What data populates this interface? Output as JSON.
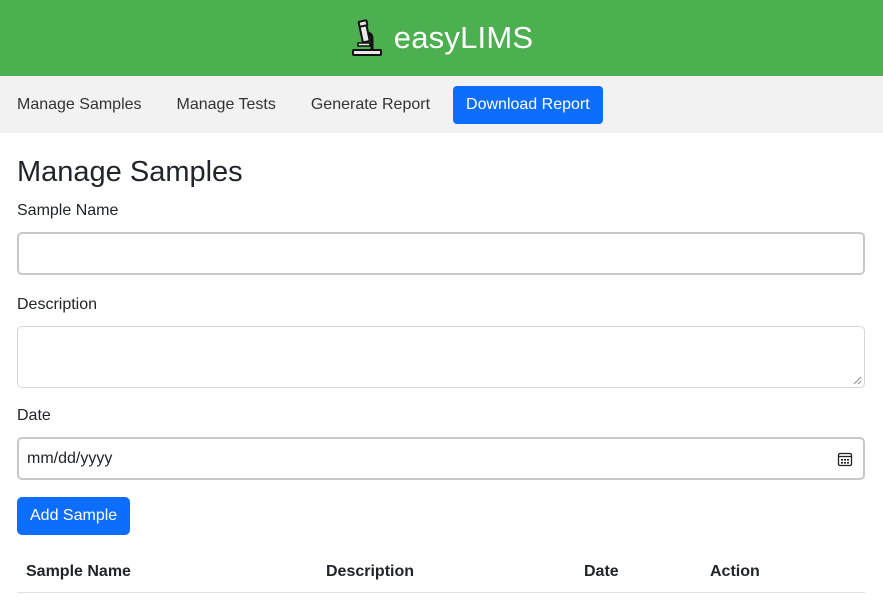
{
  "app": {
    "title": "easyLIMS",
    "icon": "microscope-icon"
  },
  "nav": {
    "items": [
      {
        "label": "Manage Samples"
      },
      {
        "label": "Manage Tests"
      },
      {
        "label": "Generate Report"
      },
      {
        "label": "Download Report",
        "active": true
      }
    ]
  },
  "page": {
    "title": "Manage Samples"
  },
  "form": {
    "sample_name": {
      "label": "Sample Name",
      "value": ""
    },
    "description": {
      "label": "Description",
      "value": ""
    },
    "date": {
      "label": "Date",
      "placeholder": "mm/dd/yyyy",
      "icon": "calendar-icon"
    },
    "submit_label": "Add Sample"
  },
  "table": {
    "columns": [
      "Sample Name",
      "Description",
      "Date",
      "Action"
    ],
    "rows": []
  },
  "colors": {
    "header_bg": "#4caf50",
    "nav_bg": "#f2f2f2",
    "primary": "#0d6efd"
  }
}
